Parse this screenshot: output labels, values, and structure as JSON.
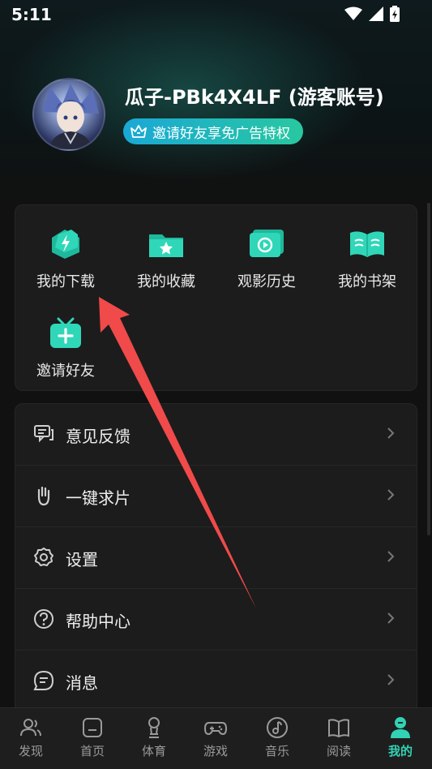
{
  "status_bar": {
    "time": "5:11"
  },
  "profile": {
    "username": "瓜子-PBk4X4LF (游客账号)",
    "invite_banner": "邀请好友享免广告特权"
  },
  "quick_actions": [
    {
      "label": "我的下载",
      "icon": "download-icon"
    },
    {
      "label": "我的收藏",
      "icon": "favorites-icon"
    },
    {
      "label": "观影历史",
      "icon": "history-icon"
    },
    {
      "label": "我的书架",
      "icon": "bookshelf-icon"
    },
    {
      "label": "邀请好友",
      "icon": "invite-icon"
    }
  ],
  "menu": [
    {
      "label": "意见反馈",
      "icon": "feedback-icon"
    },
    {
      "label": "一键求片",
      "icon": "hand-icon"
    },
    {
      "label": "设置",
      "icon": "settings-icon"
    },
    {
      "label": "帮助中心",
      "icon": "help-icon"
    },
    {
      "label": "消息",
      "icon": "message-icon"
    }
  ],
  "bottom_nav": [
    {
      "label": "发现",
      "icon": "discover-icon"
    },
    {
      "label": "首页",
      "icon": "home-icon"
    },
    {
      "label": "体育",
      "icon": "sports-icon"
    },
    {
      "label": "游戏",
      "icon": "gamepad-icon"
    },
    {
      "label": "音乐",
      "icon": "music-icon"
    },
    {
      "label": "阅读",
      "icon": "book-icon"
    },
    {
      "label": "我的",
      "icon": "profile-icon",
      "active": true
    }
  ],
  "colors": {
    "accent": "#32d2b4",
    "annotation_arrow": "#f04a4a",
    "card_bg": "#1c1c1c"
  }
}
